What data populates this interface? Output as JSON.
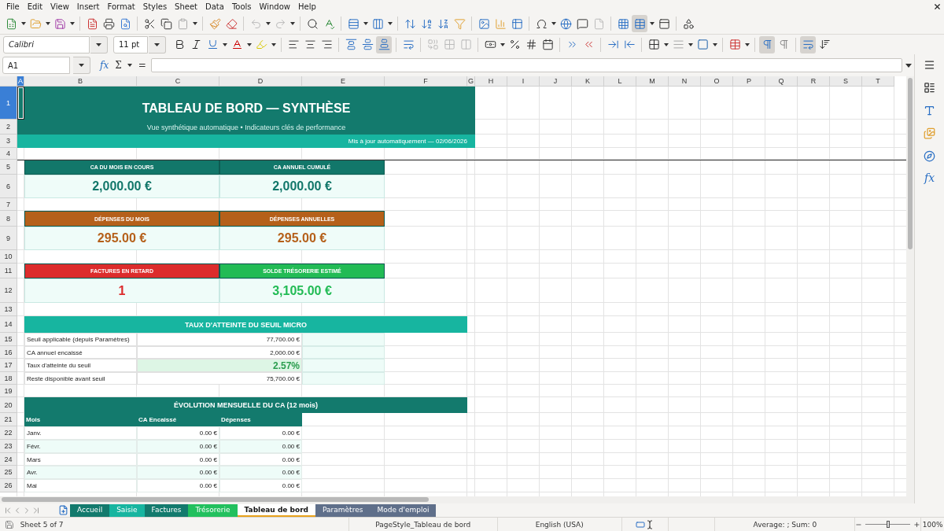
{
  "menu": [
    "File",
    "Edit",
    "View",
    "Insert",
    "Format",
    "Styles",
    "Sheet",
    "Data",
    "Tools",
    "Window",
    "Help"
  ],
  "standard_toolbar": {
    "freeze_rows_on": true
  },
  "formatting_toolbar": {
    "font_name": "Calibri",
    "font_size": "11 pt",
    "bottom_align_on": true,
    "left_to_right_on": true,
    "horizontal_text_on": true
  },
  "formula_bar": {
    "name_box": "A1",
    "function_wizard": "fx",
    "sum": "Σ",
    "equals": "="
  },
  "columns": [
    {
      "label": "A",
      "selected": true
    },
    {
      "label": "B",
      "selected": false
    },
    {
      "label": "C",
      "selected": false
    },
    {
      "label": "D",
      "selected": false
    },
    {
      "label": "E",
      "selected": false
    },
    {
      "label": "F",
      "selected": false
    },
    {
      "label": "G",
      "selected": false
    },
    {
      "label": "H",
      "selected": false
    },
    {
      "label": "I",
      "selected": false
    },
    {
      "label": "J",
      "selected": false
    },
    {
      "label": "K",
      "selected": false
    },
    {
      "label": "L",
      "selected": false
    },
    {
      "label": "M",
      "selected": false
    },
    {
      "label": "N",
      "selected": false
    },
    {
      "label": "O",
      "selected": false
    },
    {
      "label": "P",
      "selected": false
    },
    {
      "label": "Q",
      "selected": false
    },
    {
      "label": "R",
      "selected": false
    },
    {
      "label": "S",
      "selected": false
    },
    {
      "label": "T",
      "selected": false
    }
  ],
  "rows": [
    {
      "label": "1",
      "selected": true
    },
    {
      "label": "2",
      "selected": false
    },
    {
      "label": "3",
      "selected": false
    },
    {
      "label": "4",
      "selected": false
    },
    {
      "label": "5",
      "selected": false
    },
    {
      "label": "6",
      "selected": false
    },
    {
      "label": "7",
      "selected": false
    },
    {
      "label": "8",
      "selected": false
    },
    {
      "label": "9",
      "selected": false
    },
    {
      "label": "10",
      "selected": false
    },
    {
      "label": "11",
      "selected": false
    },
    {
      "label": "12",
      "selected": false
    },
    {
      "label": "13",
      "selected": false
    },
    {
      "label": "14",
      "selected": false
    },
    {
      "label": "15",
      "selected": false
    },
    {
      "label": "16",
      "selected": false
    },
    {
      "label": "17",
      "selected": false
    },
    {
      "label": "18",
      "selected": false
    },
    {
      "label": "19",
      "selected": false
    },
    {
      "label": "20",
      "selected": false
    },
    {
      "label": "21",
      "selected": false
    },
    {
      "label": "22",
      "selected": false
    },
    {
      "label": "23",
      "selected": false
    },
    {
      "label": "24",
      "selected": false
    },
    {
      "label": "25",
      "selected": false
    },
    {
      "label": "26",
      "selected": false
    }
  ],
  "dashboard": {
    "title": "TABLEAU DE BORD — SYNTHÈSE",
    "subtitle": "Vue synthétique automatique • Indicateurs clés de performance",
    "updated": "Mis à jour automatiquement — 02/06/2026",
    "kpi_rows": [
      {
        "cards": [
          {
            "label": "CA DU MOIS EN COURS",
            "value": "2,000.00 €",
            "color": "#12776a"
          },
          {
            "label": "CA ANNUEL CUMULÉ",
            "value": "2,000.00 €",
            "color": "#12776a"
          }
        ]
      },
      {
        "cards": [
          {
            "label": "DÉPENSES DU MOIS",
            "value": "295.00 €",
            "color": "#b5601a"
          },
          {
            "label": "DÉPENSES ANNUELLES",
            "value": "295.00 €",
            "color": "#b5601a"
          }
        ]
      },
      {
        "cards": [
          {
            "label": "FACTURES EN RETARD",
            "value": "1",
            "color": "#dc2c2c"
          },
          {
            "label": "SOLDE TRÉSORERIE ESTIMÉ",
            "value": "3,105.00 €",
            "color": "#22bb55"
          }
        ]
      }
    ],
    "threshold": {
      "title": "TAUX D'ATTEINTE DU SEUIL MICRO",
      "rows": [
        {
          "label": "Seuil applicable (depuis Paramètres)",
          "value": "77,700.00 €",
          "highlight": false
        },
        {
          "label": "CA annuel encaissé",
          "value": "2,000.00 €",
          "highlight": false
        },
        {
          "label": "Taux d'atteinte du seuil",
          "value": "2.57%",
          "highlight": true
        },
        {
          "label": "Reste disponible avant seuil",
          "value": "75,700.00 €",
          "highlight": false
        }
      ]
    },
    "monthly": {
      "title": "ÉVOLUTION MENSUELLE DU CA (12 mois)",
      "columns": [
        "Mois",
        "CA Encaissé",
        "Dépenses"
      ],
      "rows": [
        {
          "month": "Janv.",
          "revenue": "0.00 €",
          "expenses": "0.00 €"
        },
        {
          "month": "Févr.",
          "revenue": "0.00 €",
          "expenses": "0.00 €"
        },
        {
          "month": "Mars",
          "revenue": "0.00 €",
          "expenses": "0.00 €"
        },
        {
          "month": "Avr.",
          "revenue": "0.00 €",
          "expenses": "0.00 €"
        },
        {
          "month": "Mai",
          "revenue": "0.00 €",
          "expenses": "0.00 €"
        }
      ]
    }
  },
  "sheet_tabs": [
    {
      "label": "Accueil",
      "color": "#137a6d",
      "selected": false
    },
    {
      "label": "Saisie",
      "color": "#17b5a0",
      "selected": false
    },
    {
      "label": "Factures",
      "color": "#137a6d",
      "selected": false
    },
    {
      "label": "Trésorerie",
      "color": "#22c05e",
      "selected": false
    },
    {
      "label": "Tableau de bord",
      "color": "#e8a21c",
      "selected": true
    },
    {
      "label": "Paramètres",
      "color": "#5f6f8a",
      "selected": false
    },
    {
      "label": "Mode d'emploi",
      "color": "#5f6f8a",
      "selected": false
    }
  ],
  "sidebar": {
    "functions": "fx"
  },
  "status_bar": {
    "sheet": "Sheet 5 of 7",
    "page_style": "PageStyle_Tableau de bord",
    "language": "English (USA)",
    "selection": "Average: ; Sum: 0",
    "zoom_slider": {
      "level": 0.5
    },
    "zoom": "100%"
  }
}
